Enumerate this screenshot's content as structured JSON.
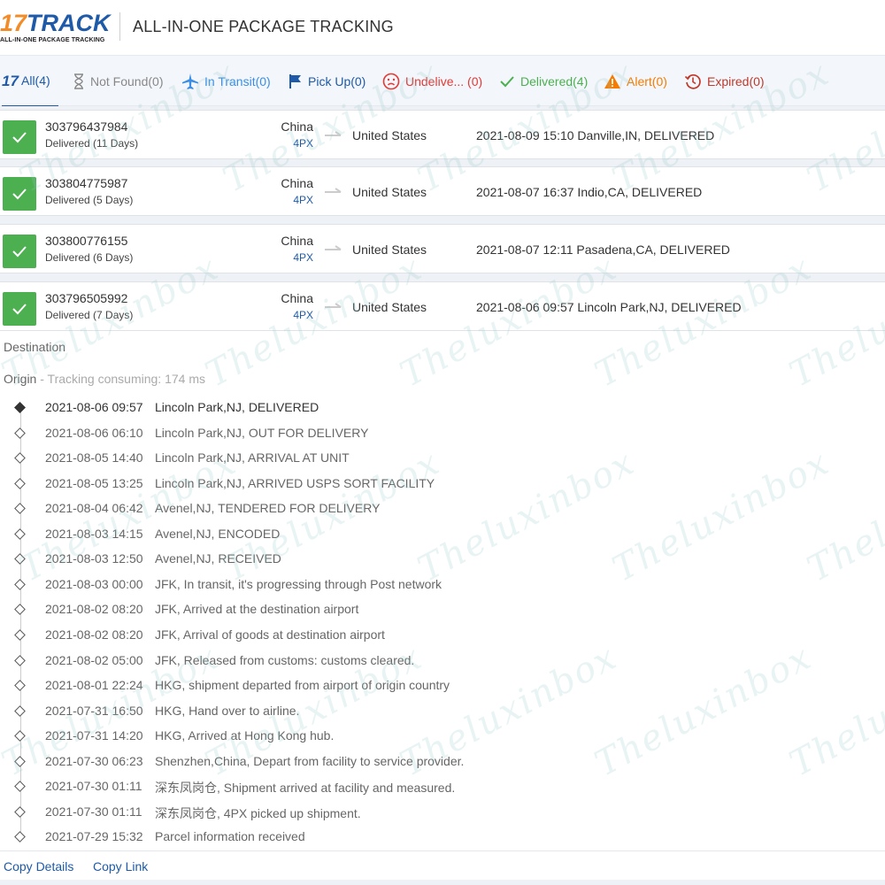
{
  "header": {
    "logo_main": "TRACK",
    "logo_num": "17",
    "logo_sub": "ALL-IN-ONE PACKAGE TRACKING",
    "title": "ALL-IN-ONE PACKAGE TRACKING"
  },
  "tabs": [
    {
      "label": "All(4)",
      "icon": "17-logo-icon",
      "color": "#1e5aa8"
    },
    {
      "label": "Not Found(0)",
      "icon": "hourglass-icon",
      "color": "#888888"
    },
    {
      "label": "In Transit(0)",
      "icon": "airplane-icon",
      "color": "#3a8ee6"
    },
    {
      "label": "Pick Up(0)",
      "icon": "flag-icon",
      "color": "#1e5aa8"
    },
    {
      "label": "Undelive... (0)",
      "icon": "sad-face-icon",
      "color": "#e53935"
    },
    {
      "label": "Delivered(4)",
      "icon": "check-icon",
      "color": "#4caf50"
    },
    {
      "label": "Alert(0)",
      "icon": "warning-icon",
      "color": "#f57c00"
    },
    {
      "label": "Expired(0)",
      "icon": "history-icon",
      "color": "#c0392b"
    }
  ],
  "packages": [
    {
      "number": "303796437984",
      "status": "Delivered (11 Days)",
      "origin": "China",
      "carrier": "4PX",
      "destination": "United States",
      "latest": "2021-08-09 15:10  Danville,IN, DELIVERED"
    },
    {
      "number": "303804775987",
      "status": "Delivered (5 Days)",
      "origin": "China",
      "carrier": "4PX",
      "destination": "United States",
      "latest": "2021-08-07 16:37  Indio,CA, DELIVERED"
    },
    {
      "number": "303800776155",
      "status": "Delivered (6 Days)",
      "origin": "China",
      "carrier": "4PX",
      "destination": "United States",
      "latest": "2021-08-07 12:11  Pasadena,CA, DELIVERED"
    },
    {
      "number": "303796505992",
      "status": "Delivered (7 Days)",
      "origin": "China",
      "carrier": "4PX",
      "destination": "United States",
      "latest": "2021-08-06 09:57  Lincoln Park,NJ, DELIVERED"
    }
  ],
  "details": {
    "destination_label": "Destination",
    "origin_label": "Origin",
    "tracking_consuming": " - Tracking consuming: 174 ms",
    "events": [
      {
        "time": "2021-08-06 09:57",
        "desc": "Lincoln Park,NJ, DELIVERED"
      },
      {
        "time": "2021-08-06 06:10",
        "desc": "Lincoln Park,NJ, OUT FOR DELIVERY"
      },
      {
        "time": "2021-08-05 14:40",
        "desc": "Lincoln Park,NJ, ARRIVAL AT UNIT"
      },
      {
        "time": "2021-08-05 13:25",
        "desc": "Lincoln Park,NJ, ARRIVED USPS SORT FACILITY"
      },
      {
        "time": "2021-08-04 06:42",
        "desc": "Avenel,NJ, TENDERED FOR DELIVERY"
      },
      {
        "time": "2021-08-03 14:15",
        "desc": "Avenel,NJ, ENCODED"
      },
      {
        "time": "2021-08-03 12:50",
        "desc": "Avenel,NJ, RECEIVED"
      },
      {
        "time": "2021-08-03 00:00",
        "desc": "JFK, In transit, it's progressing through Post network"
      },
      {
        "time": "2021-08-02 08:20",
        "desc": "JFK, Arrived at the destination airport"
      },
      {
        "time": "2021-08-02 08:20",
        "desc": "JFK, Arrival of goods at destination airport"
      },
      {
        "time": "2021-08-02 05:00",
        "desc": "JFK, Released from customs: customs cleared."
      },
      {
        "time": "2021-08-01 22:24",
        "desc": "HKG, shipment departed from airport of origin country"
      },
      {
        "time": "2021-07-31 16:50",
        "desc": "HKG, Hand over to airline."
      },
      {
        "time": "2021-07-31 14:20",
        "desc": "HKG, Arrived at Hong Kong hub."
      },
      {
        "time": "2021-07-30 06:23",
        "desc": "Shenzhen,China, Depart from facility to service provider."
      },
      {
        "time": "2021-07-30 01:11",
        "desc": "深东凤岗仓, Shipment arrived at facility and measured."
      },
      {
        "time": "2021-07-30 01:11",
        "desc": "深东凤岗仓, 4PX picked up shipment."
      },
      {
        "time": "2021-07-29 15:32",
        "desc": "Parcel information received"
      }
    ]
  },
  "footer": {
    "copy_details": "Copy Details",
    "copy_link": "Copy Link"
  },
  "watermark": "Theluxinbox"
}
